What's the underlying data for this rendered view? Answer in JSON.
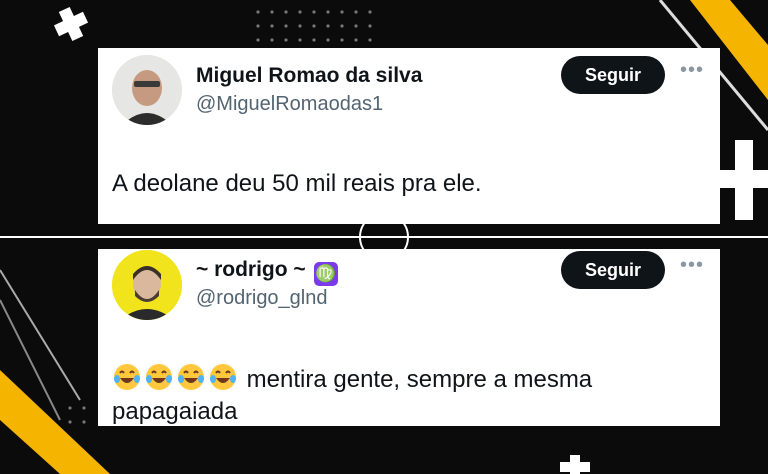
{
  "tweets": [
    {
      "author_name": "Miguel Romao da silva",
      "handle": "@MiguelRomaodas1",
      "follow_label": "Seguir",
      "more_label": "•••",
      "text": "A deolane deu 50 mil reais pra ele."
    },
    {
      "author_name": "~ rodrigo ~",
      "name_badge": "♍",
      "handle": "@rodrigo_glnd",
      "follow_label": "Seguir",
      "more_label": "•••",
      "text_line1": "mentira gente, sempre a mesma",
      "text_line2": "papagaiada",
      "emojis": [
        "face-with-tears-of-joy",
        "face-with-tears-of-joy",
        "face-with-tears-of-joy",
        "face-with-tears-of-joy"
      ]
    }
  ],
  "colors": {
    "background": "#0b0b0b",
    "accent_yellow": "#f5b400",
    "card": "#ffffff",
    "button": "#0f1419",
    "handle_gray": "#536471"
  }
}
